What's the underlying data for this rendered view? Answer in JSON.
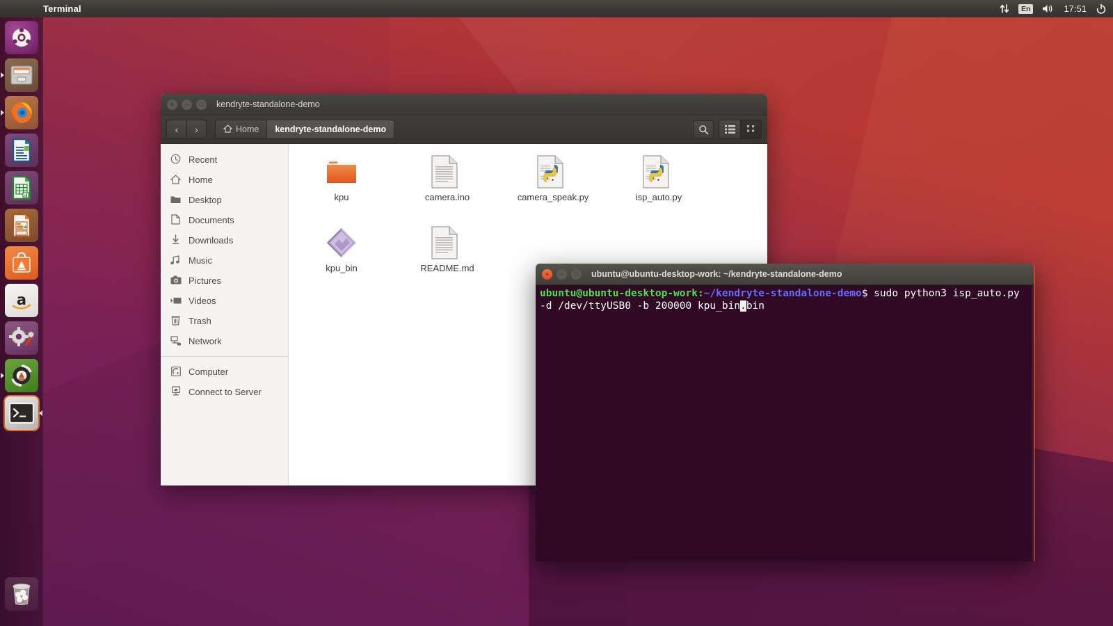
{
  "top_panel": {
    "app_title": "Terminal",
    "indicators": [
      {
        "name": "network-icon",
        "glyph": "⇅"
      },
      {
        "name": "keyboard-layout-indicator",
        "glyph": "En"
      },
      {
        "name": "volume-icon",
        "glyph": "🔊"
      }
    ],
    "clock": "17:51",
    "session_menu_icon": "power-icon"
  },
  "launcher": {
    "items": [
      {
        "name": "ubuntu-dash",
        "label": "Dash home",
        "running": false,
        "focused": false
      },
      {
        "name": "files-nautilus",
        "label": "Files",
        "running": true,
        "focused": false
      },
      {
        "name": "firefox",
        "label": "Firefox Web Browser",
        "running": true,
        "focused": false
      },
      {
        "name": "libreoffice-writer",
        "label": "LibreOffice Writer",
        "running": false,
        "focused": false
      },
      {
        "name": "libreoffice-calc",
        "label": "LibreOffice Calc",
        "running": false,
        "focused": false
      },
      {
        "name": "libreoffice-impress",
        "label": "LibreOffice Impress",
        "running": false,
        "focused": false
      },
      {
        "name": "ubuntu-software",
        "label": "Ubuntu Software",
        "running": false,
        "focused": false
      },
      {
        "name": "amazon",
        "label": "Amazon",
        "running": false,
        "focused": false
      },
      {
        "name": "system-settings",
        "label": "System Settings",
        "running": false,
        "focused": false
      },
      {
        "name": "software-updater",
        "label": "Software Updater",
        "running": true,
        "focused": false
      },
      {
        "name": "terminal",
        "label": "Terminal",
        "running": true,
        "focused": true
      }
    ],
    "trash": {
      "name": "trash",
      "label": "Trash"
    }
  },
  "files_window": {
    "title": "kendryte-standalone-demo",
    "window_buttons": {
      "close": "×",
      "minimize": "–",
      "maximize": "□"
    },
    "nav": {
      "back": "‹",
      "forward": "›"
    },
    "breadcrumbs": [
      {
        "label": "Home",
        "icon": "home-icon",
        "active": false
      },
      {
        "label": "kendryte-standalone-demo",
        "icon": "",
        "active": true
      }
    ],
    "toolbar_right": [
      {
        "name": "search-icon",
        "label": "Search"
      },
      {
        "name": "list-view-icon",
        "label": "List view"
      },
      {
        "name": "grid-view-icon",
        "label": "Icon view"
      }
    ],
    "sidebar": [
      {
        "label": "Recent",
        "icon": "clock-icon"
      },
      {
        "label": "Home",
        "icon": "home-icon"
      },
      {
        "label": "Desktop",
        "icon": "folder-icon"
      },
      {
        "label": "Documents",
        "icon": "document-icon"
      },
      {
        "label": "Downloads",
        "icon": "download-icon"
      },
      {
        "label": "Music",
        "icon": "music-icon"
      },
      {
        "label": "Pictures",
        "icon": "camera-icon"
      },
      {
        "label": "Videos",
        "icon": "video-icon"
      },
      {
        "label": "Trash",
        "icon": "trash-icon"
      },
      {
        "label": "Network",
        "icon": "network-icon"
      }
    ],
    "sidebar_bottom": [
      {
        "label": "Computer",
        "icon": "computer-icon"
      },
      {
        "label": "Connect to Server",
        "icon": "server-icon"
      }
    ],
    "files": [
      {
        "label": "kpu",
        "type": "folder"
      },
      {
        "label": "camera.ino",
        "type": "text"
      },
      {
        "label": "camera_speak.py",
        "type": "python"
      },
      {
        "label": "isp_auto.py",
        "type": "python"
      },
      {
        "label": "kpu_bin",
        "type": "binary"
      },
      {
        "label": "README.md",
        "type": "text"
      }
    ]
  },
  "terminal_window": {
    "title": "ubuntu@ubuntu-desktop-work: ~/kendryte-standalone-demo",
    "window_buttons": {
      "close": "×",
      "minimize": "–",
      "maximize": "□"
    },
    "prompt_user": "ubuntu@ubuntu-desktop-work",
    "prompt_sep": ":",
    "prompt_path": "~/kendryte-standalone-demo",
    "prompt_symbol": "$ ",
    "command_before_cursor": "sudo python3 isp_auto.py -d /dev/ttyUSB0 -b 200000 kpu_bin",
    "cursor_char": ".",
    "command_after_cursor": "bin"
  },
  "colors": {
    "ubuntu_orange": "#dd4814",
    "ubuntu_purple": "#5c1049",
    "terminal_bg": "#300a24",
    "panel_bg": "#3d3a36",
    "prompt_green": "#4ee04e",
    "prompt_blue": "#6a6aff"
  }
}
